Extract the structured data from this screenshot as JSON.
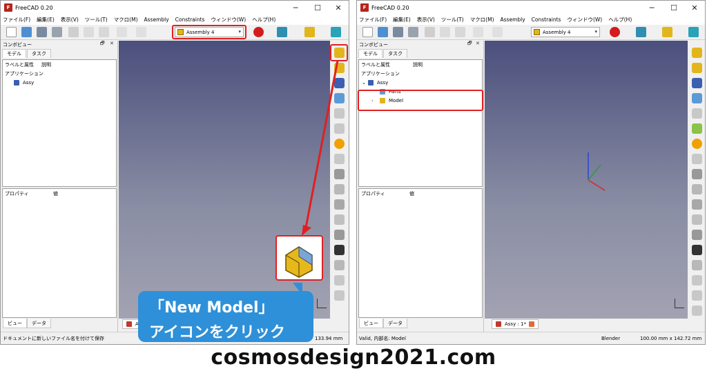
{
  "window": {
    "title": "FreeCAD 0.20",
    "min": "─",
    "max": "☐",
    "close": "✕"
  },
  "menus": [
    "ファイル(F)",
    "編集(E)",
    "表示(V)",
    "ツール(T)",
    "マクロ(M)",
    "Assembly",
    "Constraints",
    "ウィンドウ(W)",
    "ヘルプ(H)"
  ],
  "workbench": {
    "selected": "Assembly 4"
  },
  "combo": {
    "title": "コンボビュー",
    "tabs": [
      "モデル",
      "タスク"
    ],
    "float": "🗗",
    "close": "✕"
  },
  "tree": {
    "col_label": "ラベルと属性",
    "col_desc": "説明",
    "root": "アプリケーション"
  },
  "left": {
    "items": [
      {
        "label": "Assy"
      }
    ],
    "status": "ドキュメントに新しいファイル名を付けて保存",
    "coords": "133.94 mm",
    "doc_tab": "A"
  },
  "right": {
    "items": [
      {
        "label": "Assy"
      },
      {
        "label": "Parts"
      },
      {
        "label": "Model"
      }
    ],
    "status": "Valid, 内部名: Model",
    "nav": "Blender",
    "dims": "100.00 mm x 142.72 mm",
    "doc_tab": "Assy : 1*"
  },
  "props": {
    "col_prop": "プロパティ",
    "col_val": "値"
  },
  "bottom_tabs": [
    "ビュー",
    "データ"
  ],
  "callout": {
    "line1": "「New Model」",
    "line2": "アイコンをクリック"
  },
  "footer": "cosmosdesign2021.com",
  "colors": {
    "highlight": "#e02020",
    "callout": "#2e90d8",
    "view_top": "#4b4f7c",
    "view_bottom": "#a2a2b2"
  }
}
